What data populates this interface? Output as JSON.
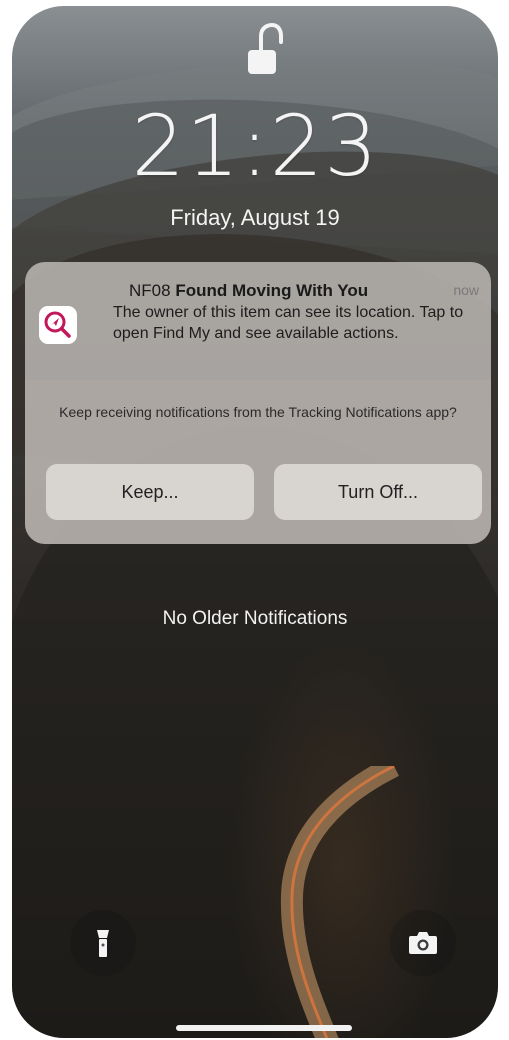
{
  "lock_screen": {
    "time": "21:23",
    "date": "Friday, August 19",
    "lock_icon": "unlocked-padlock-icon"
  },
  "notification": {
    "app_icon": "find-my-tracking-icon",
    "title_prefix": "NF08",
    "title_bold": "Found Moving With You",
    "timestamp": "now",
    "body": "The owner of this item can see its location. Tap to open Find My and see available actions.",
    "prompt": "Keep receiving notifications from the Tracking Notifications app?",
    "keep_label": "Keep...",
    "turn_off_label": "Turn Off..."
  },
  "no_older": "No Older Notifications",
  "controls": {
    "left_icon": "flashlight-icon",
    "right_icon": "camera-icon"
  },
  "colors": {
    "app_accent": "#c2185b",
    "text_light": "#f4f4f4"
  }
}
